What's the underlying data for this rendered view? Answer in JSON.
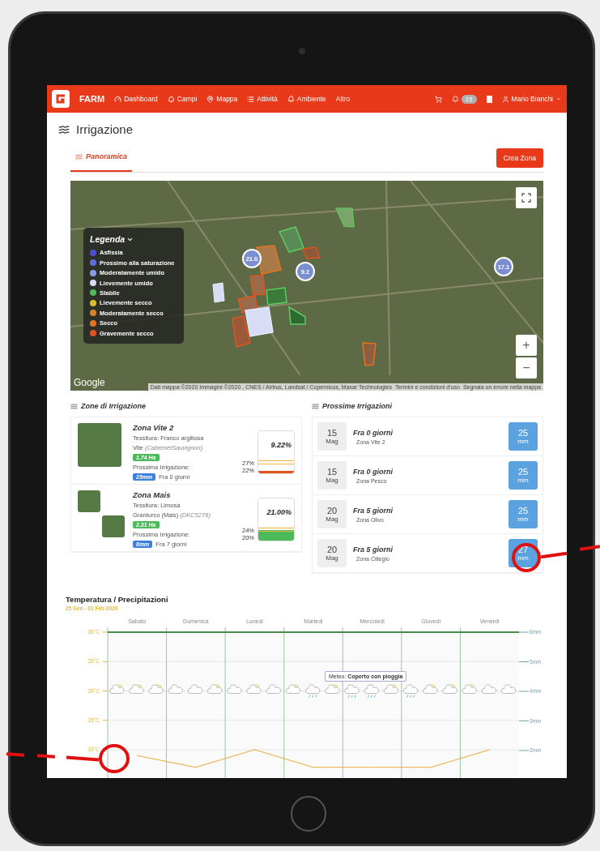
{
  "nav": {
    "brand": "FARM",
    "items": [
      "Dashboard",
      "Campi",
      "Mappa",
      "Attività",
      "Ambiente",
      "Altro"
    ],
    "notifications": "15",
    "user": "Mario Bianchi"
  },
  "page_title": "Irrigazione",
  "tabs": [
    {
      "label": "Panoramica",
      "selected": true
    }
  ],
  "create_button": "Crea Zona",
  "map": {
    "legend_title": "Legenda",
    "legend": [
      {
        "label": "Asfissia",
        "color": "#4b4fd6"
      },
      {
        "label": "Prossimo alla saturazione",
        "color": "#5c6ee0"
      },
      {
        "label": "Moderatamente umido",
        "color": "#8a9be8"
      },
      {
        "label": "Lievemente umido",
        "color": "#d8dcf5"
      },
      {
        "label": "Stabile",
        "color": "#4cba5a"
      },
      {
        "label": "Lievemente secco",
        "color": "#d9c02a"
      },
      {
        "label": "Moderatamente secco",
        "color": "#d9822a"
      },
      {
        "label": "Secco",
        "color": "#e8731f"
      },
      {
        "label": "Gravemente secco",
        "color": "#e0541f"
      }
    ],
    "markers": [
      "21.0",
      "9.2",
      "17.1"
    ],
    "logo": "Google",
    "attribution": [
      "Dati mappa ©2020 Immagini ©2020 , CNES / Airbus, Landsat / Copernicus, Maxar Technologies",
      "Termini e condizioni d'uso",
      "Segnala un errore nella mappa"
    ],
    "zoom_in": "+",
    "zoom_out": "−"
  },
  "zones_title": "Zone di Irrigazione",
  "zones": [
    {
      "name": "Zona Vite 2",
      "texture": "Tessitura: Franco argillosa",
      "crop": "Vite",
      "variety": "(CabernetSauvignon)",
      "area": "1.74 Ha",
      "next_label": "Prossima Irrigazione:",
      "amount": "25mm",
      "when": "Fra 0 giorni",
      "moisture": "9.22%",
      "upper": "27%",
      "lower": "22%",
      "level": 0.05,
      "color": "#e0541f",
      "thumbnails": [
        {
          "kind": "large"
        }
      ]
    },
    {
      "name": "Zona Mais",
      "texture": "Tessitura: Limosa",
      "crop": "Granturco (Mais)",
      "variety": "(DKC5276)",
      "area": "2.31 Ha",
      "next_label": "Prossima Irrigazione:",
      "amount": "8mm",
      "when": "Fra 7 giorni",
      "moisture": "21.00%",
      "upper": "24%",
      "lower": "20%",
      "level": 0.25,
      "color": "#4cba5a",
      "thumbnails": [
        {
          "kind": "small"
        },
        {
          "kind": "small"
        }
      ]
    }
  ],
  "upcoming_title": "Prossime Irrigazioni",
  "upcoming": [
    {
      "day": "15",
      "month": "Mag",
      "when": "Fra 0 giorni",
      "zone": "Zona Vite 2",
      "amount": "25",
      "unit": "mm"
    },
    {
      "day": "15",
      "month": "Mag",
      "when": "Fra 0 giorni",
      "zone": "Zona Pesco",
      "amount": "25",
      "unit": "mm"
    },
    {
      "day": "20",
      "month": "Mag",
      "when": "Fra 5 giorni",
      "zone": "Zona Olivo",
      "amount": "25",
      "unit": "mm"
    },
    {
      "day": "20",
      "month": "Mag",
      "when": "Fra 5 giorni",
      "zone": "Zona Ciliegio",
      "amount": "27",
      "unit": "mm"
    }
  ],
  "weather_chart": {
    "title": "Temperatura / Precipitazioni",
    "subtitle": "25 Gen - 01 Feb 2020",
    "right_axis": [
      "6mm",
      "5mm",
      "4mm",
      "3mm",
      "2mm"
    ],
    "tooltip": {
      "label": "Meteo:",
      "value": "Coperto con pioggia"
    },
    "weather": [
      {
        "kind": "sun_cloud"
      },
      {
        "kind": "sun_cloud"
      },
      {
        "kind": "sun_cloud"
      },
      {
        "kind": "cloud"
      },
      {
        "kind": "cloud"
      },
      {
        "kind": "sun_cloud"
      },
      {
        "kind": "cloud"
      },
      {
        "kind": "sun_cloud"
      },
      {
        "kind": "cloud"
      },
      {
        "kind": "sun_cloud"
      },
      {
        "kind": "rain"
      },
      {
        "kind": "sun_cloud"
      },
      {
        "kind": "rain"
      },
      {
        "kind": "rain"
      },
      {
        "kind": "sun_cloud"
      },
      {
        "kind": "rain"
      },
      {
        "kind": "sun_cloud"
      },
      {
        "kind": "sun_cloud"
      },
      {
        "kind": "sun_cloud"
      },
      {
        "kind": "cloud"
      },
      {
        "kind": "cloud"
      }
    ],
    "chart_data": {
      "type": "line",
      "grid": true,
      "categories": [
        "Sabato",
        "Domenica",
        "Lunedi",
        "Martedi",
        "Mercoledi",
        "Giovedi",
        "Venerdi"
      ],
      "yticks": [
        {
          "value": 10,
          "label": "10°C"
        },
        {
          "value": 15,
          "label": "15°C"
        },
        {
          "value": 20,
          "label": "20°C"
        },
        {
          "value": 25,
          "label": "25°C"
        },
        {
          "value": 30,
          "label": "30°C"
        }
      ],
      "ylim": [
        5,
        30
      ],
      "series": [
        {
          "color": "#e8a838",
          "values": [
            9,
            7,
            10,
            7,
            7,
            7,
            10
          ]
        }
      ]
    }
  }
}
